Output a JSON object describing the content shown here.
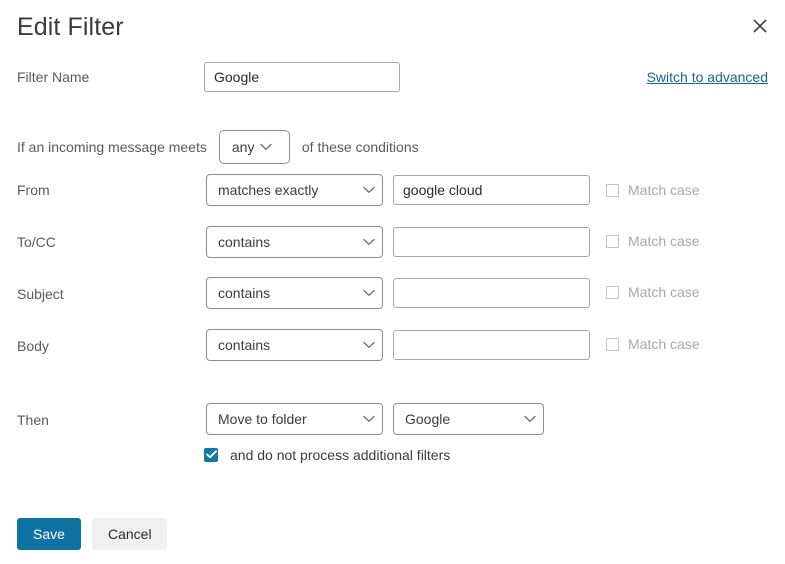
{
  "dialog": {
    "title": "Edit Filter",
    "close_icon": "close-icon",
    "advanced_link": "Switch to advanced"
  },
  "filter_name": {
    "label": "Filter Name",
    "value": "Google",
    "placeholder": ""
  },
  "conditions_sentence": {
    "prefix": "If an incoming message meets",
    "match_mode": "any",
    "suffix": "of these conditions"
  },
  "match_case_label": "Match case",
  "conditions": [
    {
      "field_label": "From",
      "operator": "matches exactly",
      "value": "google cloud",
      "placeholder": "",
      "match_case_label": "Match case",
      "match_case_checked": false,
      "match_case_disabled": true
    },
    {
      "field_label": "To/CC",
      "operator": "contains",
      "value": "",
      "placeholder": "",
      "match_case_label": "Match case",
      "match_case_checked": false,
      "match_case_disabled": true
    },
    {
      "field_label": "Subject",
      "operator": "contains",
      "value": "",
      "placeholder": "",
      "match_case_label": "Match case",
      "match_case_checked": false,
      "match_case_disabled": true
    },
    {
      "field_label": "Body",
      "operator": "contains",
      "value": "",
      "placeholder": "",
      "match_case_label": "Match case",
      "match_case_checked": false,
      "match_case_disabled": true
    }
  ],
  "action": {
    "label": "Then",
    "action_type": "Move to folder",
    "target_folder": "Google",
    "stop_processing_label": "and do not process additional filters",
    "stop_processing_checked": true
  },
  "footer": {
    "save_label": "Save",
    "cancel_label": "Cancel"
  },
  "colors": {
    "accent": "#0e73a3",
    "link": "#15688f",
    "checkbox_checked": "#1479a8",
    "cancel_bg": "#f0f0f0",
    "label_text": "#5b5b5b",
    "disabled_text": "#a8a8a8"
  }
}
